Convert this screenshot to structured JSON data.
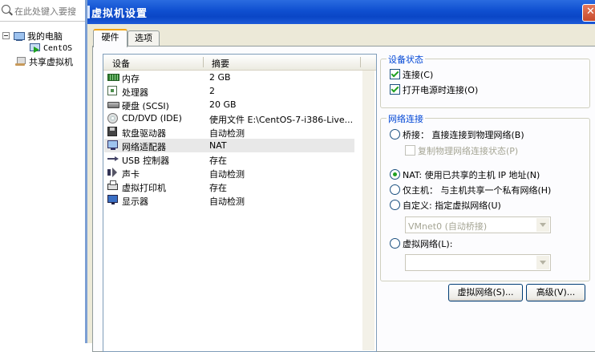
{
  "library": {
    "search_placeholder": "在此处键入要搜",
    "my_computer": "我的电脑",
    "vm_name": "CentOS",
    "shared_vms": "共享虚拟机"
  },
  "dialog": {
    "title": "虚拟机设置",
    "tabs": {
      "hardware": "硬件",
      "options": "选项"
    }
  },
  "devices": {
    "col_device": "设备",
    "col_summary": "摘要",
    "rows": [
      {
        "icon": "memory-icon",
        "name": "内存",
        "summary": "2 GB"
      },
      {
        "icon": "processor-icon",
        "name": "处理器",
        "summary": "2"
      },
      {
        "icon": "hard-disk-icon",
        "name": "硬盘 (SCSI)",
        "summary": "20 GB"
      },
      {
        "icon": "cd-dvd-icon",
        "name": "CD/DVD (IDE)",
        "summary": "使用文件 E:\\CentOS-7-i386-Live..."
      },
      {
        "icon": "floppy-icon",
        "name": "软盘驱动器",
        "summary": "自动检测"
      },
      {
        "icon": "network-adapter-icon",
        "name": "网络适配器",
        "summary": "NAT"
      },
      {
        "icon": "usb-icon",
        "name": "USB 控制器",
        "summary": "存在"
      },
      {
        "icon": "sound-card-icon",
        "name": "声卡",
        "summary": "自动检测"
      },
      {
        "icon": "printer-icon",
        "name": "虚拟打印机",
        "summary": "存在"
      },
      {
        "icon": "display-icon",
        "name": "显示器",
        "summary": "自动检测"
      }
    ],
    "selected_index": 5
  },
  "device_status": {
    "title": "设备状态",
    "connected": "连接(C)",
    "connect_at_power_on": "打开电源时连接(O)"
  },
  "network": {
    "title": "网络连接",
    "bridged": "桥接： 直接连接到物理网络(B)",
    "replicate": "复制物理网络连接状态(P)",
    "nat": "NAT: 使用已共享的主机 IP 地址(N)",
    "host_only": "仅主机： 与主机共享一个私有网络(H)",
    "custom": "自定义: 指定虚拟网络(U)",
    "custom_select": "VMnet0 (自动桥接)",
    "lan_segment": "虚拟网络(L):",
    "lan_select": "",
    "selected": "nat"
  },
  "buttons": {
    "virtual_network": "虚拟网络(S)...",
    "advanced": "高级(V)..."
  }
}
